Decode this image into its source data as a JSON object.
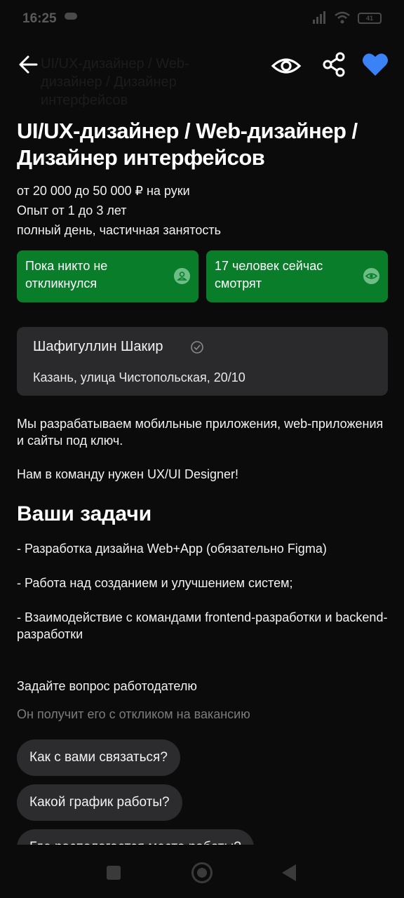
{
  "status_bar": {
    "time": "16:25",
    "battery": "41"
  },
  "toolbar": {
    "title": "UI/UX-дизайнер / Web-дизайнер / Дизайнер интерфейсов",
    "heart_color": "#3b82f6"
  },
  "vacancy": {
    "title": "UI/UX-дизайнер / Web-дизайнер / Дизайнер интерфейсов",
    "salary": "от 20 000 до 50 000 ₽ на руки",
    "experience": "Опыт от 1 до 3 лет",
    "schedule": "полный день, частичная занятость"
  },
  "badges": [
    {
      "text": "Пока никто не откликнулся",
      "icon": "person-icon",
      "color": "#0a7d2a"
    },
    {
      "text": "17 человек сейчас смотрят",
      "icon": "eye-icon",
      "color": "#0a7d2a"
    }
  ],
  "employer": {
    "name": "Шафигуллин Шакир",
    "address": "Казань, улица Чистопольская, 20/10"
  },
  "description": {
    "p1": "Мы разрабатываем мобильные приложения, web-приложения и сайты под ключ.",
    "p2": "Нам в команду нужен UX/UI Designer!"
  },
  "tasks": {
    "heading": "Ваши задачи",
    "items": [
      "- Разработка дизайна Web+App (обязательно Figma)",
      "- Работа над созданием и улучшением систем;",
      "- Взаимодействие с командами frontend-разработки и backend-разработки"
    ]
  },
  "ask": {
    "title": "Задайте вопрос работодателю",
    "subtitle": "Он получит его с откликом на вакансию",
    "chips": [
      "Как с вами связаться?",
      "Какой график работы?",
      "Где располагается место работы?"
    ]
  }
}
